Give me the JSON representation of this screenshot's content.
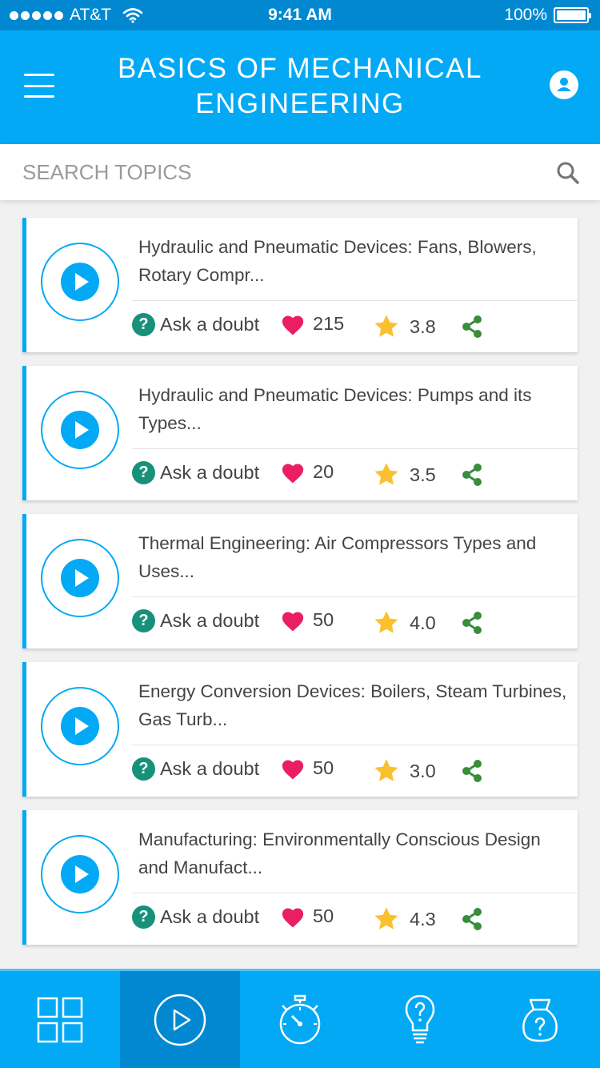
{
  "status_bar": {
    "carrier": "AT&T",
    "time": "9:41 AM",
    "battery": "100%"
  },
  "header": {
    "title": "BASICS OF MECHANICAL ENGINEERING"
  },
  "search": {
    "placeholder": "SEARCH TOPICS",
    "value": ""
  },
  "ask_label": "Ask a doubt",
  "videos": [
    {
      "title": "Hydraulic and Pneumatic Devices: Fans, Blowers, Rotary Compr...",
      "likes": "215",
      "rating": "3.8"
    },
    {
      "title": "Hydraulic and Pneumatic Devices: Pumps and its Types...",
      "likes": "20",
      "rating": "3.5"
    },
    {
      "title": "Thermal Engineering: Air Compressors Types and Uses...",
      "likes": "50",
      "rating": "4.0"
    },
    {
      "title": "Energy Conversion Devices: Boilers, Steam Turbines, Gas Turb...",
      "likes": "50",
      "rating": "3.0"
    },
    {
      "title": "Manufacturing: Environmentally Conscious Design and Manufact...",
      "likes": "50",
      "rating": "4.3"
    }
  ],
  "tabs": [
    {
      "icon": "grid-icon",
      "active": false
    },
    {
      "icon": "play-circle-icon",
      "active": true
    },
    {
      "icon": "stopwatch-icon",
      "active": false
    },
    {
      "icon": "lightbulb-icon",
      "active": false
    },
    {
      "icon": "question-bag-icon",
      "active": false
    }
  ],
  "colors": {
    "primary": "#03a9f4",
    "primary_dark": "#0288d1",
    "heart": "#e91e63",
    "star": "#fbc02d",
    "share": "#388e3c",
    "question": "#17917a"
  }
}
